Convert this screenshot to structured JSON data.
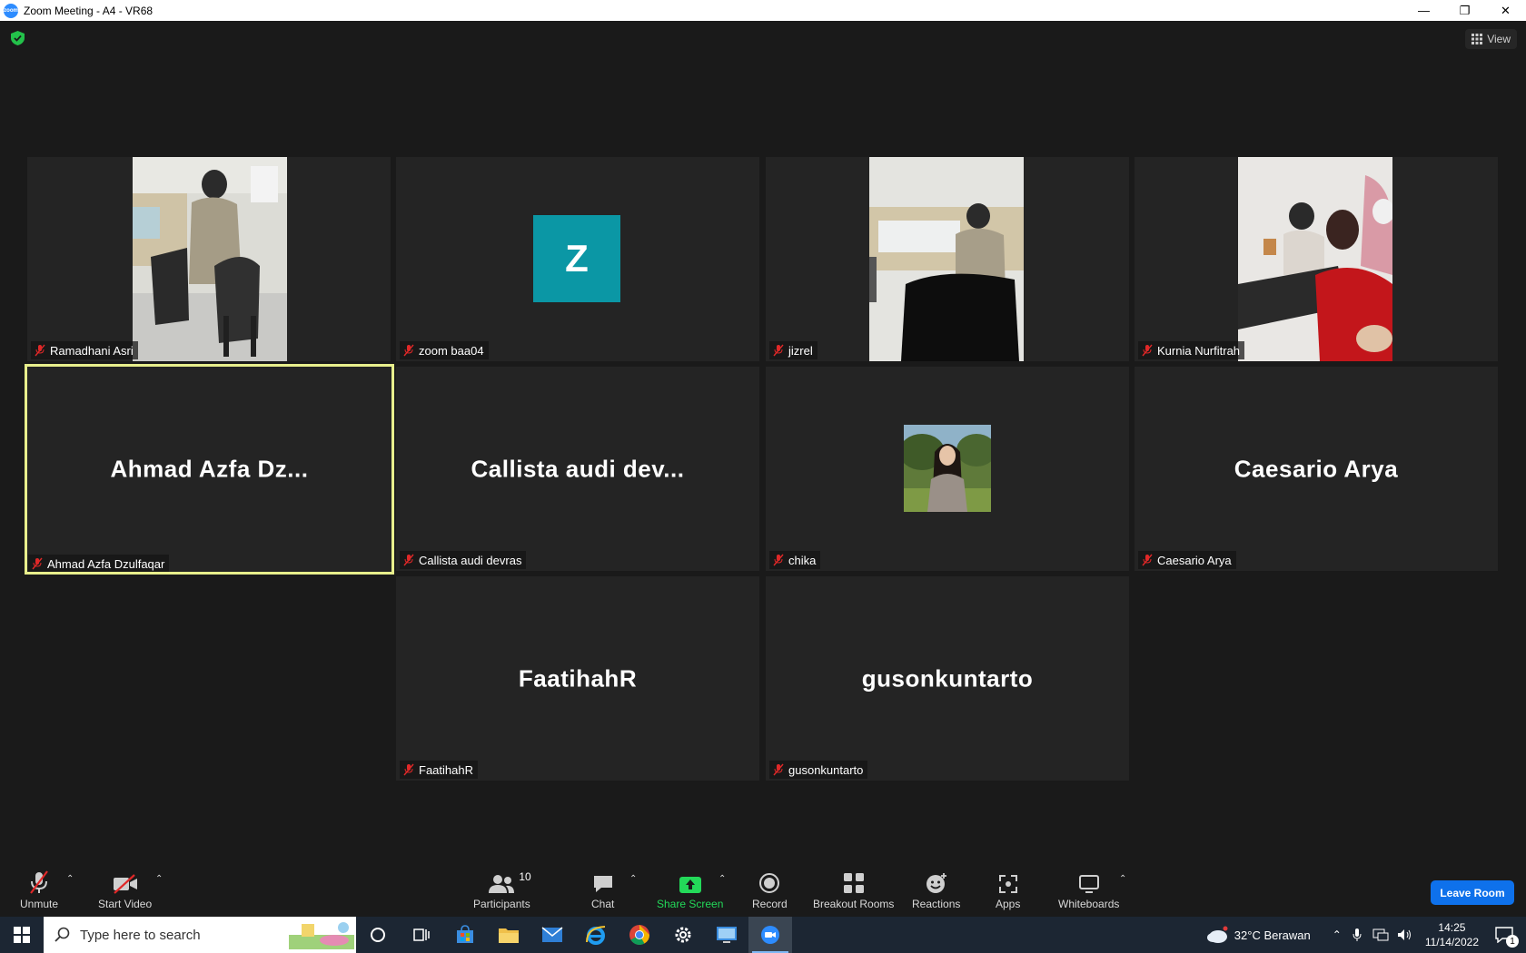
{
  "window": {
    "title": "Zoom Meeting - A4 - VR68",
    "app_icon_text": "zoom"
  },
  "view_label": "View",
  "tiles": [
    {
      "name": "Ramadhani Asri"
    },
    {
      "name": "zoom baa04",
      "avatar_letter": "Z"
    },
    {
      "name": "jizrel"
    },
    {
      "name": "Kurnia Nurfitrah"
    },
    {
      "name": "Ahmad Azfa Dzulfaqar",
      "display": "Ahmad Azfa Dz..."
    },
    {
      "name": "Callista audi devras",
      "display": "Callista audi dev..."
    },
    {
      "name": "chika"
    },
    {
      "name": "Caesario Arya",
      "display": "Caesario Arya"
    },
    {
      "name": "FaatihahR",
      "display": "FaatihahR"
    },
    {
      "name": "gusonkuntarto",
      "display": "gusonkuntarto"
    }
  ],
  "toolbar": {
    "unmute": "Unmute",
    "start_video": "Start Video",
    "participants": "Participants",
    "participants_count": "10",
    "chat": "Chat",
    "share_screen": "Share Screen",
    "record": "Record",
    "breakout_rooms": "Breakout Rooms",
    "reactions": "Reactions",
    "apps": "Apps",
    "whiteboards": "Whiteboards",
    "leave": "Leave Room"
  },
  "taskbar": {
    "search_placeholder": "Type here to search",
    "weather": "32°C  Berawan",
    "time": "14:25",
    "date": "11/14/2022",
    "notification_count": "1"
  },
  "colors": {
    "active_speaker": "#e8ef8c",
    "share_green": "#23d959",
    "leave_blue": "#0e71eb",
    "avatar_teal": "#0b97a5"
  }
}
